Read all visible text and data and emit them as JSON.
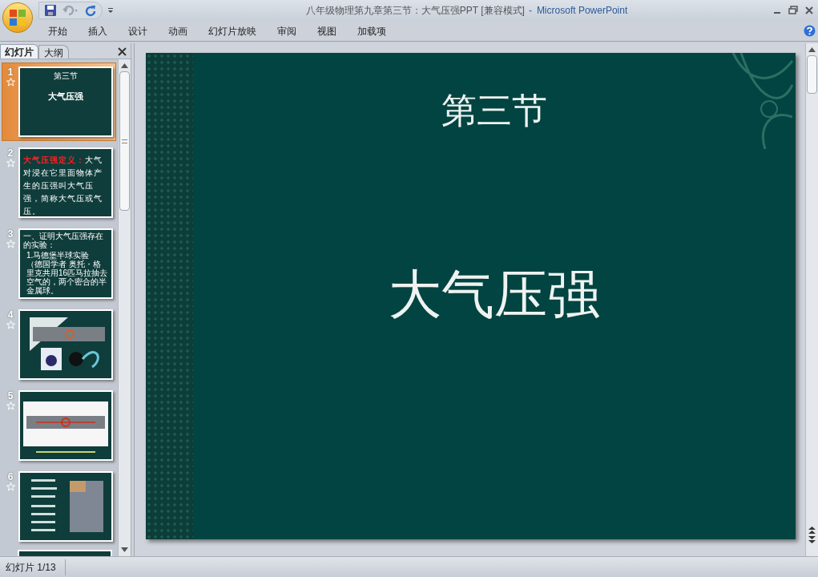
{
  "window": {
    "title": "八年级物理第九章第三节：大气压强PPT [兼容模式]",
    "separator": "-",
    "app": "Microsoft PowerPoint"
  },
  "ribbon_tabs": [
    {
      "label": "开始",
      "selected": false
    },
    {
      "label": "插入",
      "selected": false
    },
    {
      "label": "设计",
      "selected": false
    },
    {
      "label": "动画",
      "selected": false
    },
    {
      "label": "幻灯片放映",
      "selected": false
    },
    {
      "label": "审阅",
      "selected": false
    },
    {
      "label": "视图",
      "selected": false
    },
    {
      "label": "加载项",
      "selected": false
    }
  ],
  "pane_tabs": [
    {
      "label": "幻灯片",
      "selected": true
    },
    {
      "label": "大纲",
      "selected": false
    }
  ],
  "slides": [
    {
      "number": "1",
      "selected": true,
      "kind": "title",
      "heading": "第三节",
      "title": "大气压强"
    },
    {
      "number": "2",
      "selected": false,
      "kind": "definition",
      "lead": "大气压强定义：",
      "body": "大气对浸在它里面物体产生的压强叫大气压强，简称大气压或气压。"
    },
    {
      "number": "3",
      "selected": false,
      "kind": "list",
      "heading": "一、证明大气压强存在的实验：",
      "lines": [
        "1.马德堡半球实验",
        "（德国学者 奥托・格",
        "里克共用16匹马拉抽去",
        "空气的，两个密合的半",
        "金属球。"
      ]
    },
    {
      "number": "4",
      "selected": false,
      "kind": "collage"
    },
    {
      "number": "5",
      "selected": false,
      "kind": "banner"
    },
    {
      "number": "6",
      "selected": false,
      "kind": "photo"
    },
    {
      "kind": "partial"
    }
  ],
  "current_slide": {
    "heading": "第三节",
    "title": "大气压强"
  },
  "status_bar": {
    "slide_counter": "幻灯片 1/13"
  }
}
